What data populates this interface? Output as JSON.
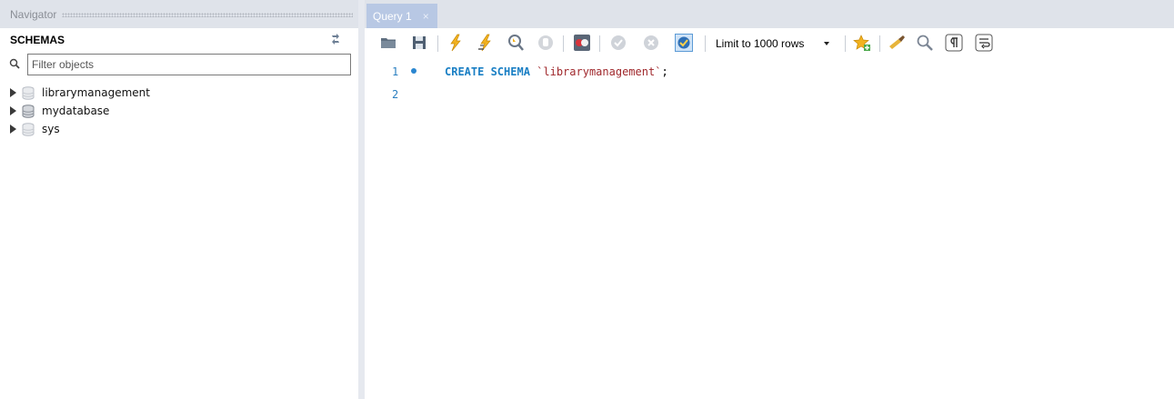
{
  "navigator": {
    "title": "Navigator",
    "schemas_label": "SCHEMAS",
    "filter_placeholder": "Filter objects",
    "schemas": [
      {
        "name": "librarymanagement",
        "bold": false
      },
      {
        "name": "mydatabase",
        "bold": false
      },
      {
        "name": "sys",
        "bold": false
      }
    ]
  },
  "editor": {
    "tab": {
      "label": "Query 1",
      "close": "×"
    },
    "toolbar": {
      "limit_label": "Limit to 1000 rows",
      "icons": [
        "open-folder-icon",
        "save-icon",
        "execute-icon",
        "execute-current-icon",
        "explain-icon",
        "stop-icon",
        "toggle-error-icon",
        "commit-icon",
        "rollback-icon",
        "autocommit-icon",
        "add-snippet-icon",
        "beautify-icon",
        "find-icon",
        "invisible-chars-icon",
        "word-wrap-icon"
      ]
    },
    "lines": [
      {
        "number": "1",
        "keyword": "CREATE SCHEMA",
        "string": "`librarymanagement`",
        "punct": ";"
      },
      {
        "number": "2",
        "keyword": "",
        "string": "",
        "punct": ""
      }
    ]
  },
  "colors": {
    "header_bg": "#dfe3ea",
    "tab_bg": "#b8c8e4",
    "keyword": "#1a7fc4",
    "string": "#a0282c",
    "line_number": "#2a7fc0"
  }
}
